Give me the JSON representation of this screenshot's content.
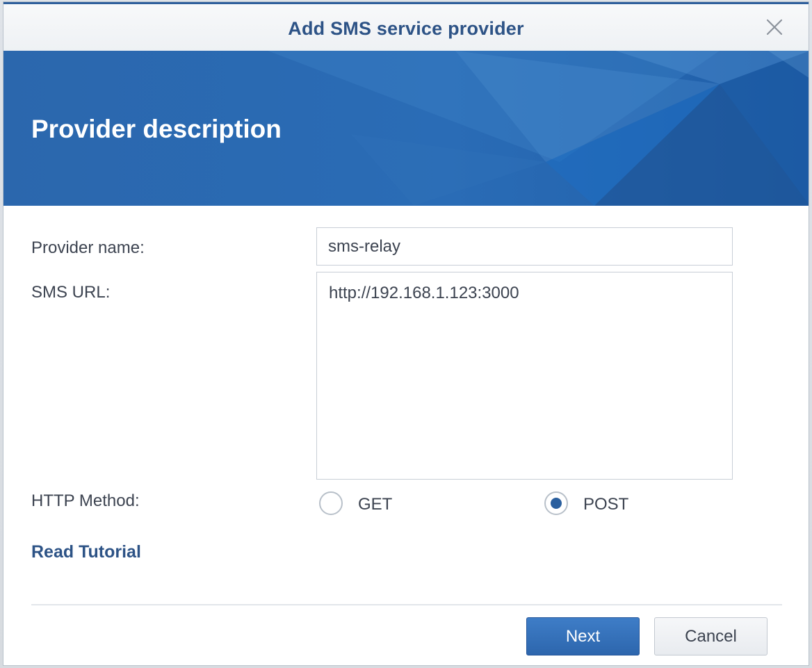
{
  "dialog": {
    "title": "Add SMS service provider",
    "close_icon": "close-icon"
  },
  "banner": {
    "title": "Provider description"
  },
  "form": {
    "provider_name": {
      "label": "Provider name:",
      "value": "sms-relay"
    },
    "sms_url": {
      "label": "SMS URL:",
      "value": "http://192.168.1.123:3000"
    },
    "http_method": {
      "label": "HTTP Method:",
      "options": [
        "GET",
        "POST"
      ],
      "selected": "POST"
    }
  },
  "links": {
    "tutorial": "Read Tutorial"
  },
  "buttons": {
    "next": "Next",
    "cancel": "Cancel"
  },
  "colors": {
    "accent": "#2d5386",
    "banner": "#2a6ab3",
    "primary_button": "#3573bb"
  }
}
